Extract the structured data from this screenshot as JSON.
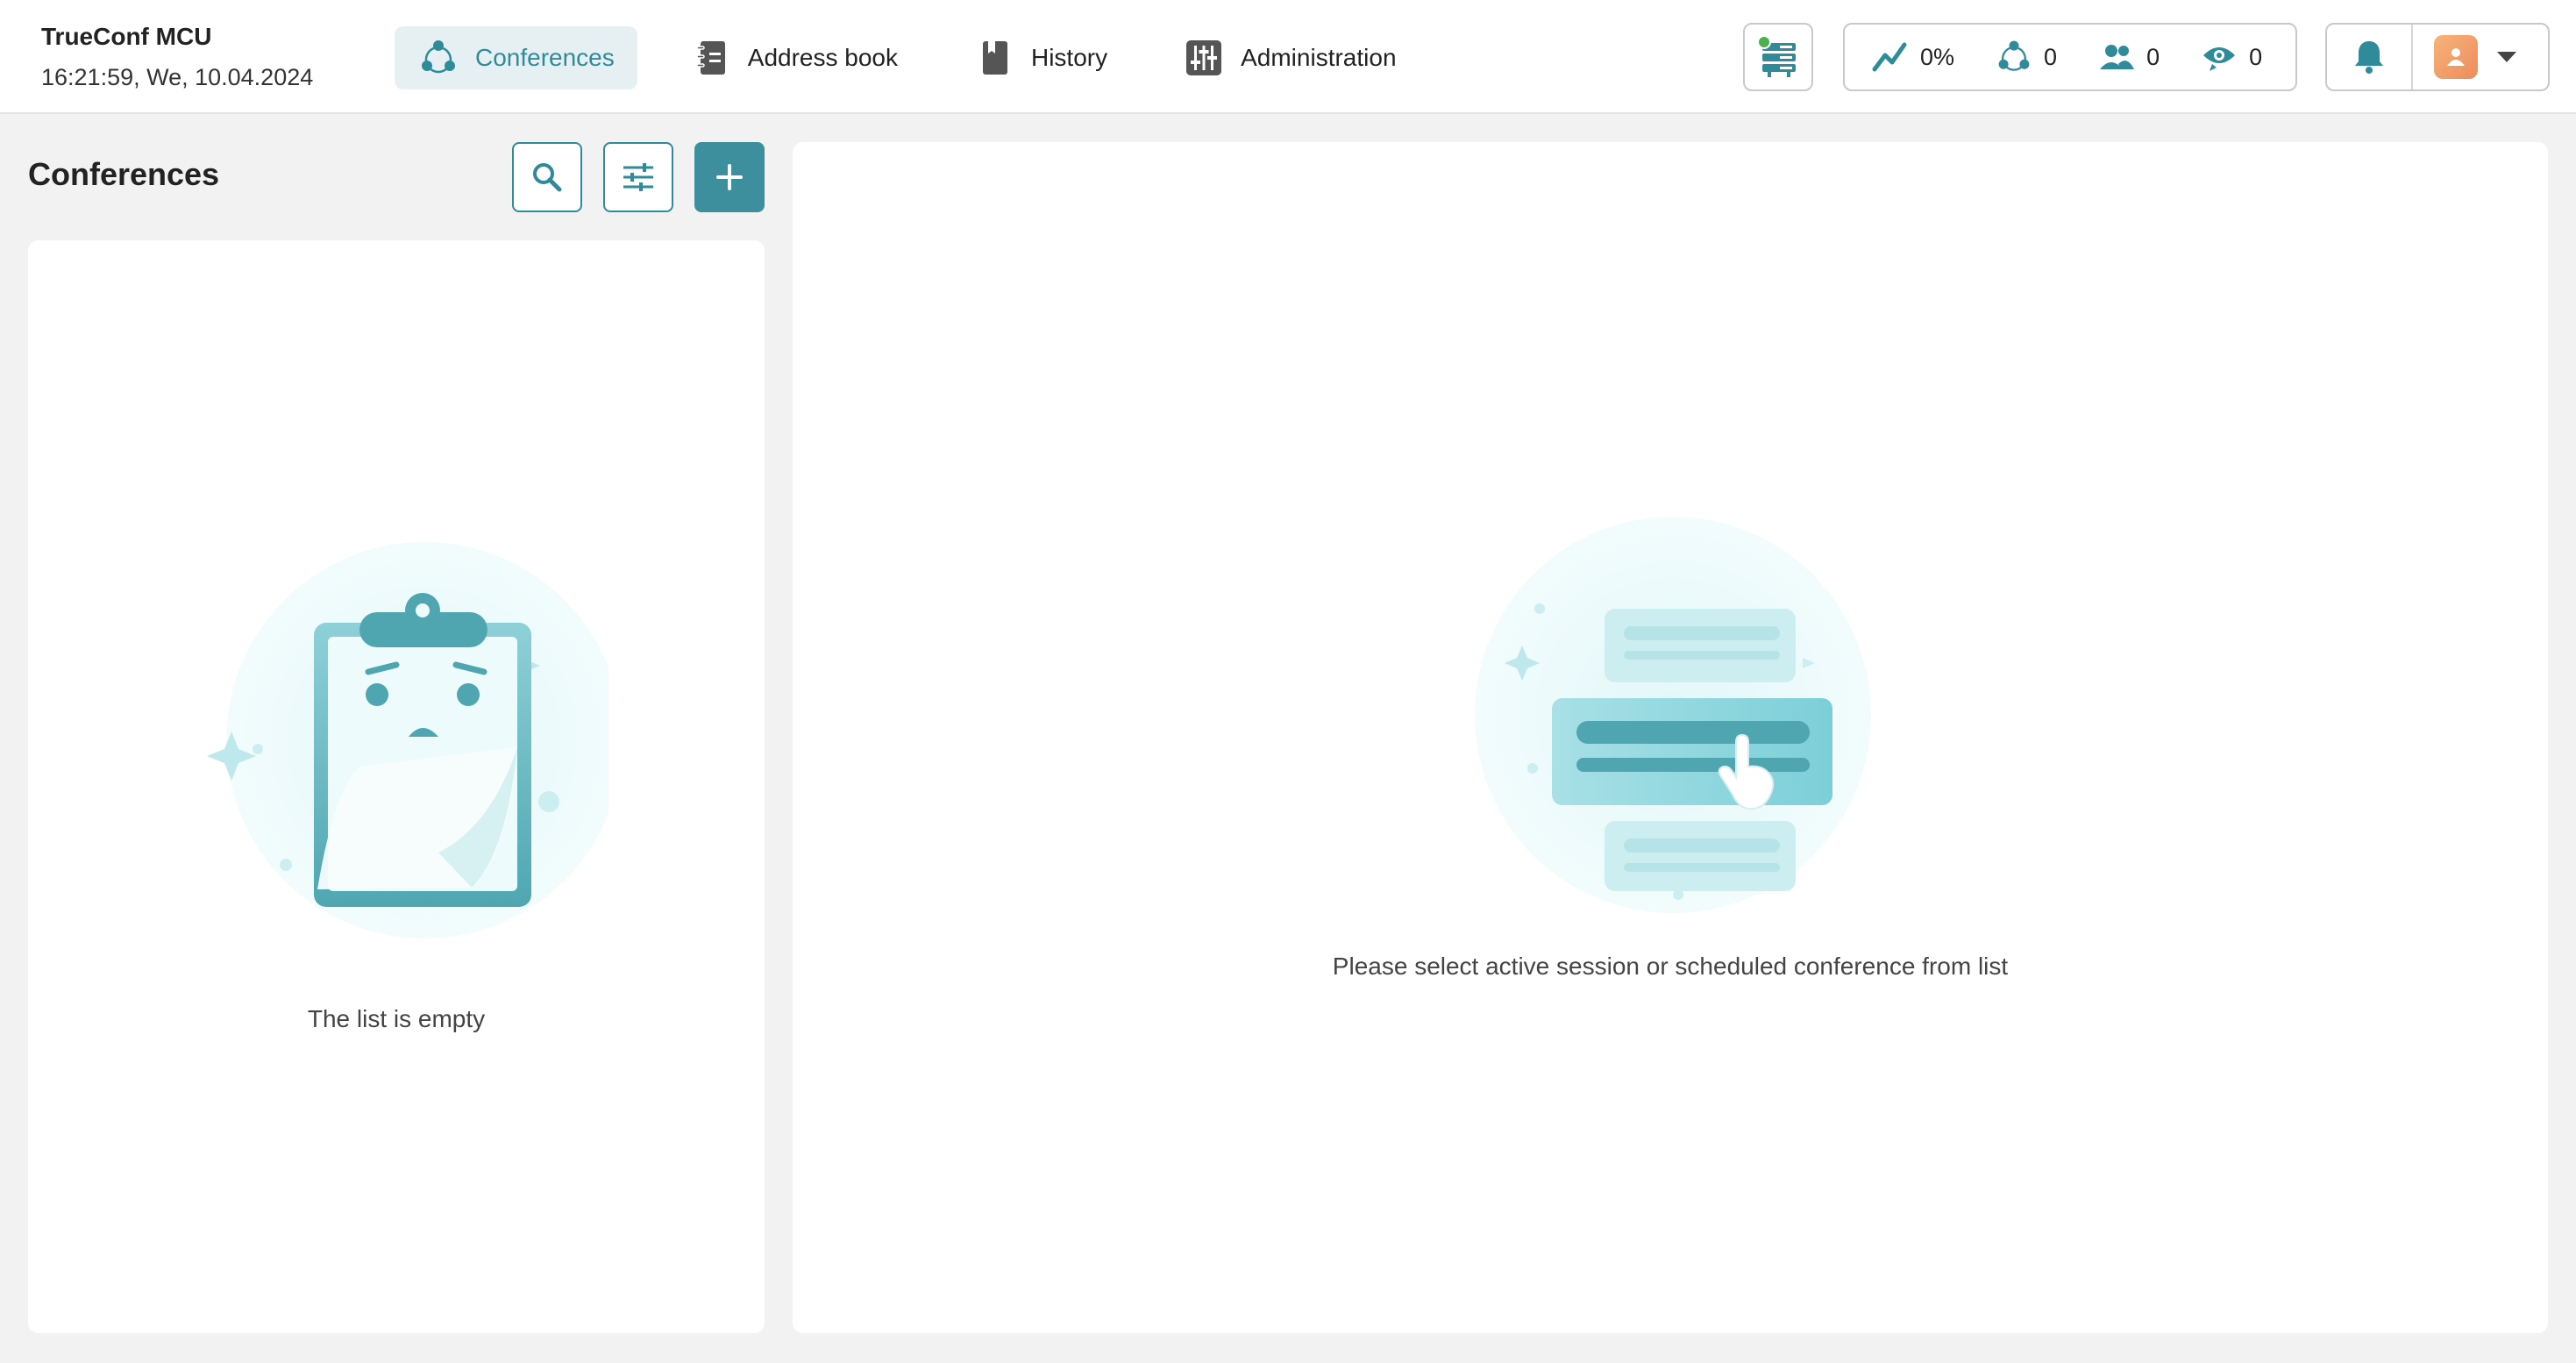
{
  "app": {
    "name": "TrueConf MCU",
    "clock": "16:21:59, We, 10.04.2024"
  },
  "nav": {
    "items": [
      {
        "label": "Conferences",
        "icon": "conferences-icon",
        "active": true
      },
      {
        "label": "Address book",
        "icon": "address-book-icon",
        "active": false
      },
      {
        "label": "History",
        "icon": "history-icon",
        "active": false
      },
      {
        "label": "Administration",
        "icon": "administration-icon",
        "active": false
      }
    ]
  },
  "stats": {
    "load": "0%",
    "conferences": "0",
    "participants": "0",
    "viewers": "0"
  },
  "server_status": {
    "online": true,
    "status_color": "#4caf50"
  },
  "colors": {
    "accent": "#3d8f9d",
    "active_tab_bg": "#e6f0f2"
  },
  "left": {
    "title": "Conferences",
    "empty_text": "The list is empty"
  },
  "detail": {
    "placeholder": "Please select active session or scheduled conference from list"
  }
}
